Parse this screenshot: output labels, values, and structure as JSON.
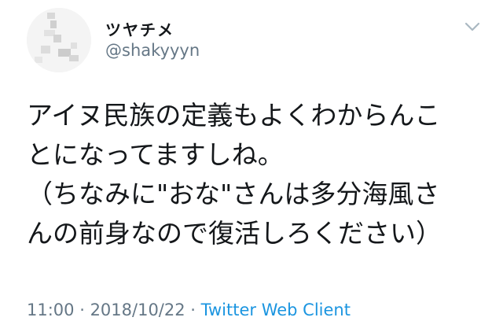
{
  "tweet": {
    "author": {
      "display_name": "ツヤチメ",
      "handle": "@shakyyyn",
      "avatar_icon": "avatar-image"
    },
    "menu_icon": "chevron-down-icon",
    "text_lines": [
      "アイヌ民族の定義もよくわからんこ",
      "とになってますしね。",
      "（ちなみに\"おな\"さんは多分海風さ",
      "んの前身なので復活しろください）"
    ],
    "time": "11:00",
    "separator": " · ",
    "date": "2018/10/22",
    "source": "Twitter Web Client"
  },
  "colors": {
    "text": "#14171a",
    "secondary": "#657786",
    "link": "#1b95e0"
  }
}
